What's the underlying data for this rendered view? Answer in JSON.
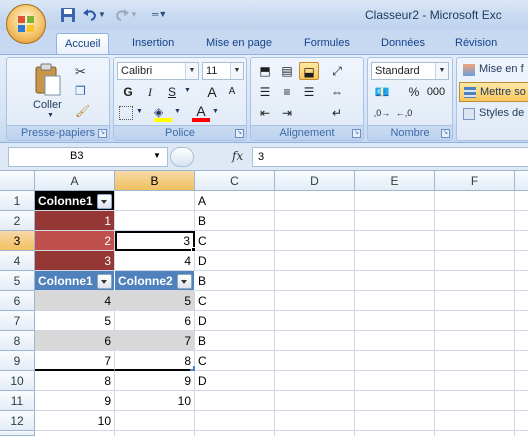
{
  "window": {
    "title": "Classeur2 - Microsoft Exc"
  },
  "ribbon": {
    "tabs": [
      "Accueil",
      "Insertion",
      "Mise en page",
      "Formules",
      "Données",
      "Révision"
    ],
    "active_tab": "Accueil",
    "clipboard": {
      "paste_label": "Coller",
      "group_label": "Presse-papiers"
    },
    "font": {
      "name": "Calibri",
      "size": "11",
      "bold": "G",
      "italic": "I",
      "underline": "S",
      "grow": "A",
      "shrink": "A",
      "color_glyph": "A",
      "group_label": "Police"
    },
    "alignment": {
      "group_label": "Alignement"
    },
    "number": {
      "format": "Standard",
      "percent": "%",
      "thousands": "000",
      "group_label": "Nombre"
    },
    "styles": {
      "conditional": "Mise en f",
      "as_table": "Mettre so",
      "cell_styles": "Styles de"
    }
  },
  "formula_bar": {
    "name_box": "B3",
    "fx": "fx",
    "formula": "3"
  },
  "sheet": {
    "columns": [
      "A",
      "B",
      "C",
      "D",
      "E",
      "F"
    ],
    "rows": [
      "1",
      "2",
      "3",
      "4",
      "5",
      "6",
      "7",
      "8",
      "9",
      "10",
      "11",
      "12"
    ],
    "cells": {
      "A1": "Colonne1",
      "C1": "A",
      "A2": "1",
      "C2": "B",
      "A3": "2",
      "B3": "3",
      "C3": "C",
      "A4": "3",
      "B4": "4",
      "C4": "D",
      "A5": "Colonne1",
      "B5": "Colonne2",
      "C5": "B",
      "A6": "4",
      "B6": "5",
      "C6": "C",
      "A7": "5",
      "B7": "6",
      "C7": "D",
      "A8": "6",
      "B8": "7",
      "C8": "B",
      "A9": "7",
      "B9": "8",
      "C9": "C",
      "A10": "8",
      "B10": "9",
      "C10": "D",
      "A11": "9",
      "B11": "10",
      "A12": "10"
    },
    "active_cell": "B3",
    "colors": {
      "header_black": "#000000",
      "table_blue": "#4f81bd",
      "dark_red": "#953735",
      "red": "#c0504d",
      "band_grey": "#d8d8d8",
      "selection": "#f1c15f"
    }
  }
}
